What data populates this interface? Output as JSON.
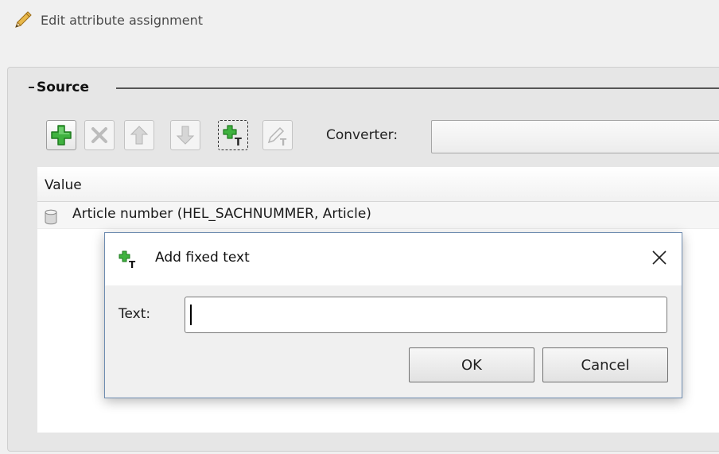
{
  "header": {
    "title": "Edit attribute assignment",
    "icon": "pencil-icon"
  },
  "source": {
    "legend": "Source",
    "toolbar": [
      {
        "name": "add-button",
        "icon": "green-plus-icon",
        "state": "enabled"
      },
      {
        "name": "remove-button",
        "icon": "remove-x-icon",
        "state": "disabled"
      },
      {
        "name": "move-up-button",
        "icon": "arrow-up-icon",
        "state": "disabled"
      },
      {
        "name": "move-down-button",
        "icon": "arrow-down-icon",
        "state": "disabled"
      },
      {
        "name": "add-fixed-text-button",
        "icon": "add-text-icon",
        "state": "active"
      },
      {
        "name": "edit-fixed-text-button",
        "icon": "edit-text-icon",
        "state": "disabled"
      }
    ],
    "converter_label": "Converter:",
    "converter_value": "",
    "table": {
      "columns": [
        "Value"
      ],
      "rows": [
        {
          "icon": "database-icon",
          "value": "Article number (HEL_SACHNUMMER, Article)"
        }
      ]
    }
  },
  "dialog": {
    "title": "Add fixed text",
    "text_label": "Text:",
    "text_value": "",
    "ok_label": "OK",
    "cancel_label": "Cancel"
  },
  "colors": {
    "accent_green": "#3aa63a",
    "dialog_border": "#6e8cb0"
  }
}
